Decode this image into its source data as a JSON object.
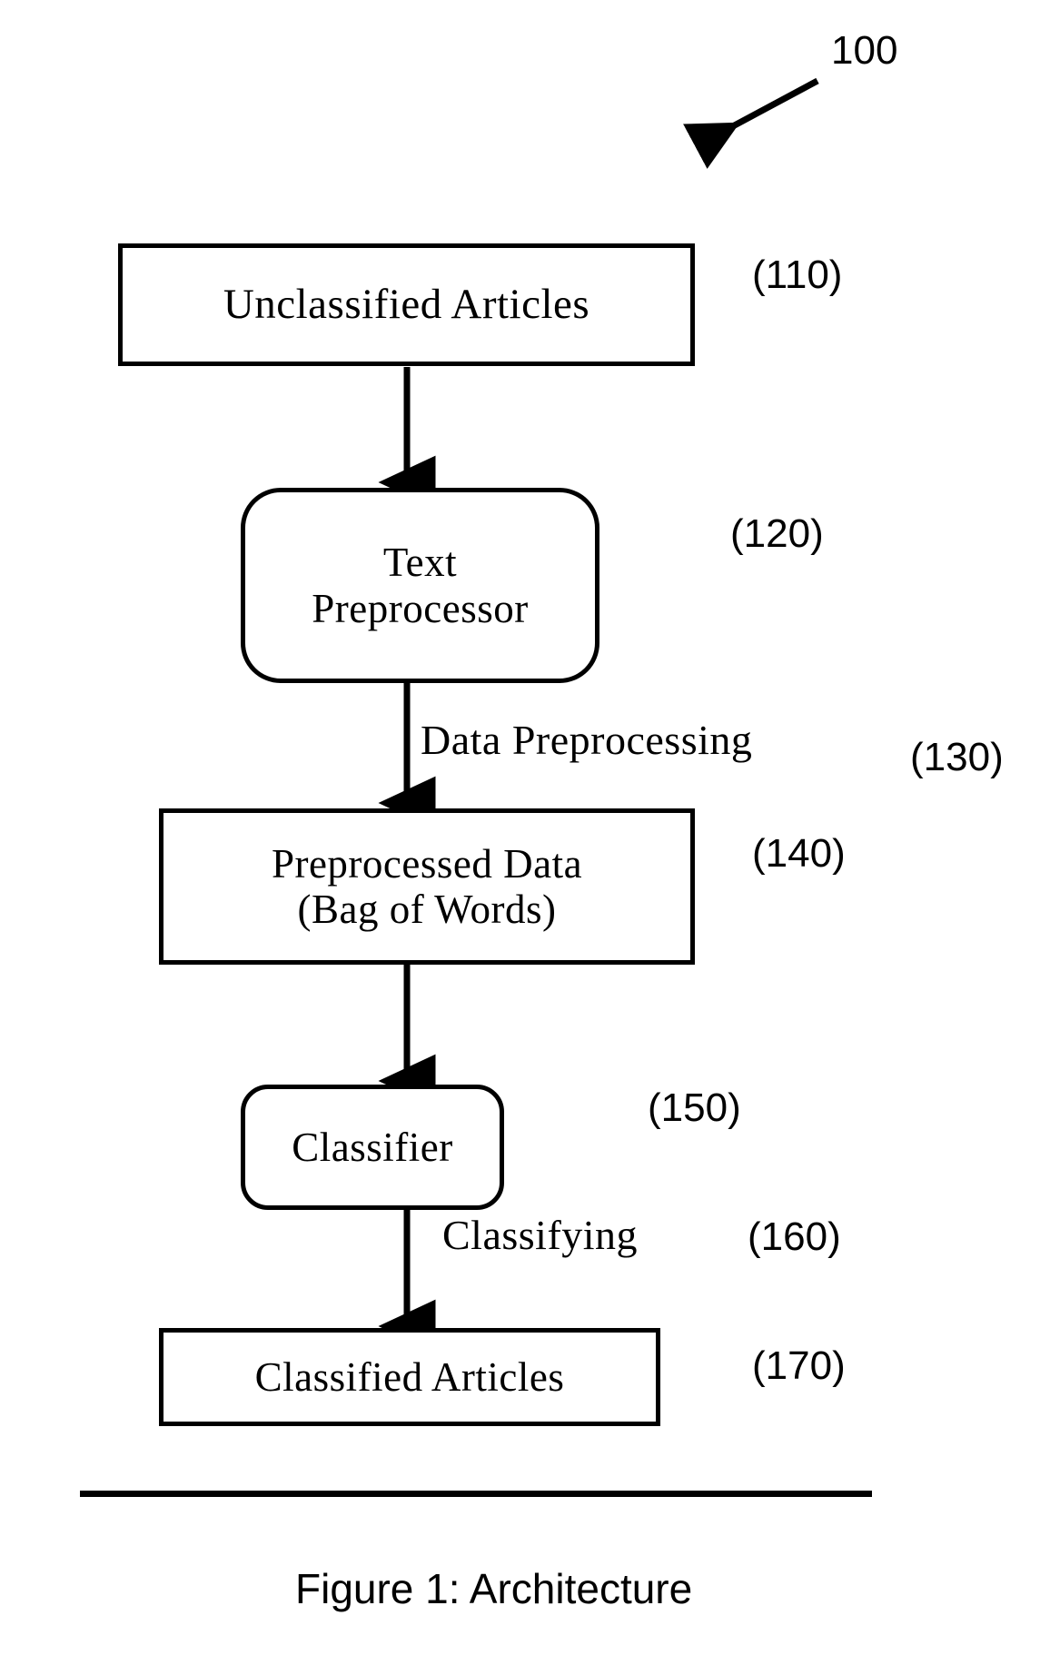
{
  "figure": {
    "number_label": "100",
    "caption": "Figure 1:  Architecture"
  },
  "nodes": [
    {
      "id": "unclassified-articles",
      "shape": "rectangle",
      "text": "Unclassified Articles",
      "ref": "(110)"
    },
    {
      "id": "text-preprocessor",
      "shape": "rounded-rectangle",
      "line1": "Text",
      "line2": "Preprocessor",
      "ref": "(120)"
    },
    {
      "id": "preprocessed-data",
      "shape": "rectangle",
      "line1": "Preprocessed Data",
      "line2": "(Bag of Words)",
      "ref": "(140)"
    },
    {
      "id": "classifier",
      "shape": "rounded-rectangle",
      "text": "Classifier",
      "ref": "(150)"
    },
    {
      "id": "classified-articles",
      "shape": "rectangle",
      "text": "Classified Articles",
      "ref": "(170)"
    }
  ],
  "edges": [
    {
      "id": "edge-unclassified-to-preprocessor",
      "label": "",
      "ref": ""
    },
    {
      "id": "edge-preprocessor-to-preprocessed",
      "label": "Data Preprocessing",
      "ref": "(130)"
    },
    {
      "id": "edge-preprocessed-to-classifier",
      "label": "",
      "ref": ""
    },
    {
      "id": "edge-classifier-to-classified",
      "label": "Classifying",
      "ref": "(160)"
    }
  ],
  "colors": {
    "ink": "#000000",
    "paper": "#ffffff"
  }
}
